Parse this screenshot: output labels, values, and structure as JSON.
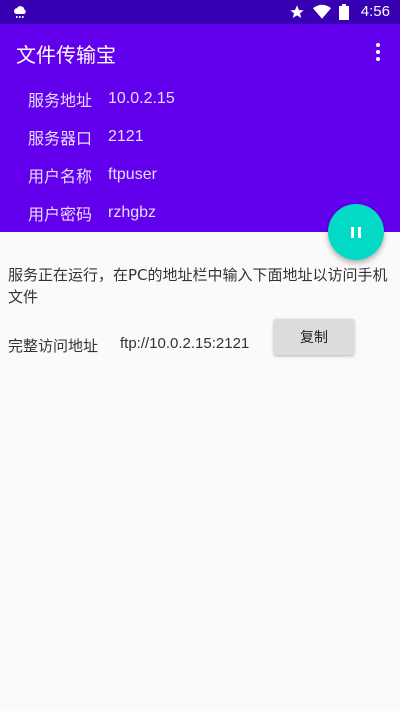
{
  "status_bar": {
    "time": "4:56",
    "left_icon": "weather-cloud-icon",
    "icons": [
      "star-icon",
      "wifi-icon",
      "battery-icon"
    ]
  },
  "app_bar": {
    "title": "文件传输宝",
    "overflow_icon": "more-vert-icon"
  },
  "info": [
    {
      "label": "服务地址",
      "value": "10.0.2.15"
    },
    {
      "label": "服务器口",
      "value": "2121"
    },
    {
      "label": "用户名称",
      "value": "ftpuser"
    },
    {
      "label": "用户密码",
      "value": "rzhgbz"
    }
  ],
  "fab": {
    "icon": "pause-icon"
  },
  "main": {
    "message": "服务正在运行，在PC的地址栏中输入下面地址以访问手机文件",
    "address_label": "完整访问地址",
    "address_value": "ftp://10.0.2.15:2121",
    "copy_label": "复制"
  },
  "colors": {
    "status_bar": "#3700b3",
    "primary": "#6200ee",
    "accent": "#03dac5",
    "background": "#fafafa"
  }
}
